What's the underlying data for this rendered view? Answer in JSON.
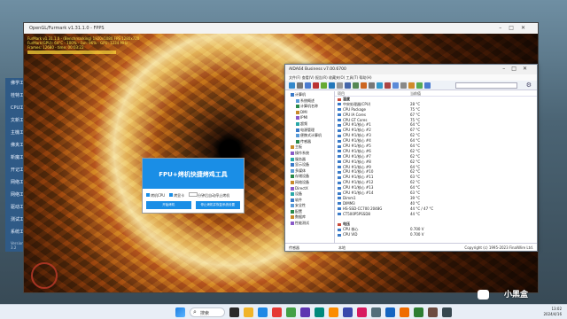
{
  "left_app": {
    "items": [
      "佛学工",
      "桂特工",
      "CPU工",
      "文新工",
      "主機工",
      "佛夹工",
      "新魔工",
      "开记工",
      "网络工",
      "网络工",
      "驱动工",
      "测试工",
      "系统工"
    ],
    "version": "Version: 3.2"
  },
  "bg_window": {
    "title": "OpenGL/Furmark v1.31.1.0 - FPPS",
    "osd_lines": [
      "FurMark v1.31.1.0 - (Benchmarking) 1920x1080 FPS 1280x720",
      "FurMark(GPU): 64°C - 100% - Fan: 96% - GPU: 1234 MHz",
      "Frames: 12680 - time: 00:03:22"
    ]
  },
  "fpu": {
    "title": "FPU+烤机快捷烤鸡工具",
    "opt_cpu": "烤机CPU",
    "opt_gpu": "烤显卡",
    "opt_time": "分钟后自动停止烤机",
    "btn_start": "开始烤机",
    "btn_stop": "停止烤机并恢复系统设置"
  },
  "aida": {
    "title": "AIDA64 Business v7.00.6700",
    "menu": "文件(F)  查看(V)  报告(R)  收藏夹(O)  工具(T)  帮助(H)",
    "tree": [
      {
        "t": "计算机",
        "lvl": 0
      },
      {
        "t": "系统概述",
        "lvl": 1
      },
      {
        "t": "计算机名称",
        "lvl": 1
      },
      {
        "t": "DMI",
        "lvl": 1
      },
      {
        "t": "IPMI",
        "lvl": 1
      },
      {
        "t": "超频",
        "lvl": 1
      },
      {
        "t": "电源管理",
        "lvl": 1
      },
      {
        "t": "便携式计算机",
        "lvl": 1
      },
      {
        "t": "传感器",
        "lvl": 1
      },
      {
        "t": "主板",
        "lvl": 0
      },
      {
        "t": "操作系统",
        "lvl": 0
      },
      {
        "t": "服务器",
        "lvl": 0
      },
      {
        "t": "显示设备",
        "lvl": 0
      },
      {
        "t": "多媒体",
        "lvl": 0
      },
      {
        "t": "存储设备",
        "lvl": 0
      },
      {
        "t": "网络设备",
        "lvl": 0
      },
      {
        "t": "DirectX",
        "lvl": 0
      },
      {
        "t": "设备",
        "lvl": 0
      },
      {
        "t": "软件",
        "lvl": 0
      },
      {
        "t": "安全性",
        "lvl": 0
      },
      {
        "t": "配置",
        "lvl": 0
      },
      {
        "t": "数据库",
        "lvl": 0
      },
      {
        "t": "性能测试",
        "lvl": 0
      }
    ],
    "col_item": "项目",
    "col_value": "当前值",
    "rows": [
      {
        "n": "温度",
        "v": "",
        "g": true
      },
      {
        "n": "中央处理器(CPU)",
        "v": "28 °C"
      },
      {
        "n": "CPU Package",
        "v": "75 °C"
      },
      {
        "n": "CPU IA Cores",
        "v": "67 °C"
      },
      {
        "n": "CPU GT Cores",
        "v": "75 °C"
      },
      {
        "n": "CPU #1/核心 #1",
        "v": "64 °C"
      },
      {
        "n": "CPU #1/核心 #2",
        "v": "67 °C"
      },
      {
        "n": "CPU #1/核心 #3",
        "v": "62 °C"
      },
      {
        "n": "CPU #1/核心 #4",
        "v": "64 °C"
      },
      {
        "n": "CPU #1/核心 #5",
        "v": "64 °C"
      },
      {
        "n": "CPU #1/核心 #6",
        "v": "62 °C"
      },
      {
        "n": "CPU #1/核心 #7",
        "v": "62 °C"
      },
      {
        "n": "CPU #1/核心 #8",
        "v": "62 °C"
      },
      {
        "n": "CPU #1/核心 #9",
        "v": "64 °C"
      },
      {
        "n": "CPU #1/核心 #10",
        "v": "62 °C"
      },
      {
        "n": "CPU #1/核心 #11",
        "v": "63 °C"
      },
      {
        "n": "CPU #1/核心 #12",
        "v": "62 °C"
      },
      {
        "n": "CPU #1/核心 #13",
        "v": "64 °C"
      },
      {
        "n": "CPU #1/核心 #14",
        "v": "63 °C"
      },
      {
        "n": "Dimm1",
        "v": "39 °C"
      },
      {
        "n": "DIMM3",
        "v": "40 °C"
      },
      {
        "n": "HS-SSD-CC700 2048G",
        "v": "44 °C / 47 °C"
      },
      {
        "n": "CT500P5PSSD8",
        "v": "44 °C"
      },
      {
        "n": "",
        "v": ""
      },
      {
        "n": "电压",
        "v": "",
        "g": true
      },
      {
        "n": "CPU 核心",
        "v": "0.700 V"
      },
      {
        "n": "CPU VID",
        "v": "0.700 V"
      }
    ],
    "status_left": "传感器",
    "status_mid": "本地",
    "status_right": "Copyright (c) 1995-2023 FinalWire Ltd."
  },
  "taskbar": {
    "search": "搜索",
    "time": "13:02",
    "date": "2024/4/16"
  },
  "watermark": "小黑盒"
}
